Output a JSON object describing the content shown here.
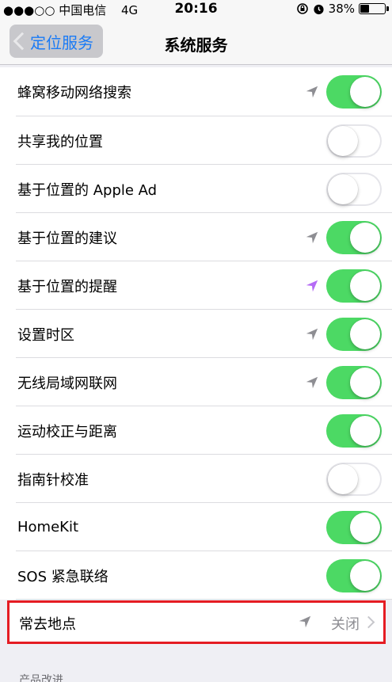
{
  "status_bar": {
    "carrier": "●●●○○ 中国电信",
    "network": "4G",
    "time": "20:16",
    "battery_percent": "38%",
    "battery_level": 0.38
  },
  "nav": {
    "back_label": "定位服务",
    "title": "系统服务"
  },
  "rows": [
    {
      "label": "蜂窝移动网络搜索",
      "toggle": true,
      "arrow": "gray"
    },
    {
      "label": "共享我的位置",
      "toggle": false,
      "arrow": ""
    },
    {
      "label": "基于位置的 Apple Ad",
      "toggle": false,
      "arrow": ""
    },
    {
      "label": "基于位置的建议",
      "toggle": true,
      "arrow": "gray"
    },
    {
      "label": "基于位置的提醒",
      "toggle": true,
      "arrow": "purple"
    },
    {
      "label": "设置时区",
      "toggle": true,
      "arrow": "gray"
    },
    {
      "label": "无线局域网联网",
      "toggle": true,
      "arrow": "gray"
    },
    {
      "label": "运动校正与距离",
      "toggle": true,
      "arrow": ""
    },
    {
      "label": "指南针校准",
      "toggle": false,
      "arrow": ""
    },
    {
      "label": "HomeKit",
      "toggle": true,
      "arrow": ""
    },
    {
      "label": "SOS 紧急联络",
      "toggle": true,
      "arrow": ""
    }
  ],
  "frequent_locations": {
    "label": "常去地点",
    "value": "关闭",
    "arrow": "gray"
  },
  "section_footer": "产品改进",
  "colors": {
    "toggle_on": "#4cd964",
    "arrow_gray": "#8e8e93",
    "arrow_purple": "#b56bf5",
    "highlight": "#e51c23",
    "link": "#1b7bf5"
  }
}
